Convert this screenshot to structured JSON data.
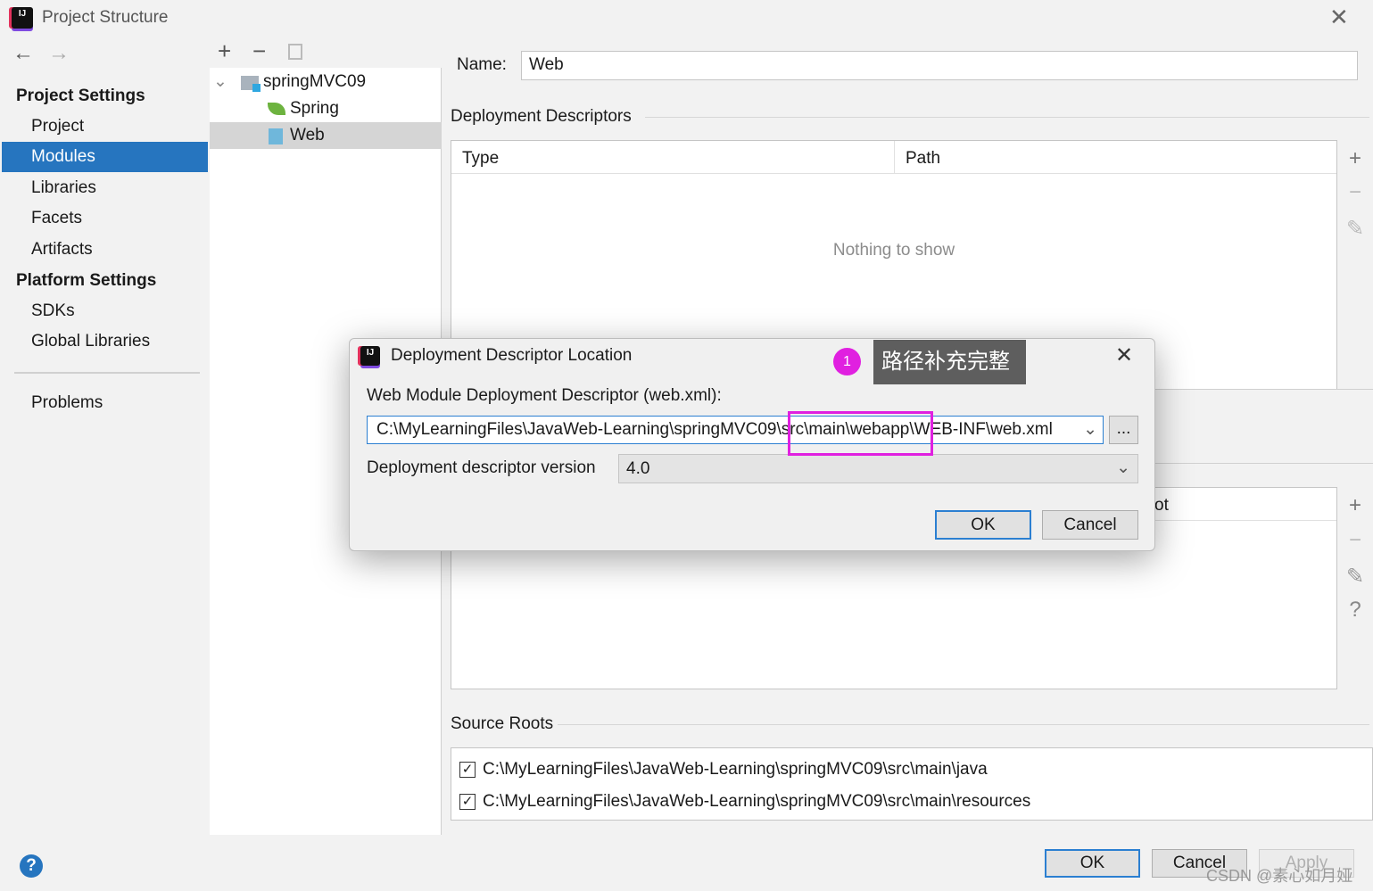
{
  "window": {
    "title": "Project Structure",
    "close_icon": "close-icon"
  },
  "sidebar": {
    "project_settings": "Project Settings",
    "items_top": [
      {
        "label": "Project"
      },
      {
        "label": "Modules",
        "selected": true
      },
      {
        "label": "Libraries"
      },
      {
        "label": "Facets"
      },
      {
        "label": "Artifacts"
      }
    ],
    "platform_settings": "Platform Settings",
    "items_platform": [
      {
        "label": "SDKs"
      },
      {
        "label": "Global Libraries"
      }
    ],
    "problems": "Problems"
  },
  "tree": {
    "root": "springMVC09",
    "children": [
      {
        "label": "Spring"
      },
      {
        "label": "Web",
        "selected": true
      }
    ]
  },
  "right": {
    "name_label": "Name:",
    "name_value": "Web",
    "deployment_descriptors": "Deployment Descriptors",
    "columns": [
      "Type",
      "Path"
    ],
    "empty_text": "Nothing to show",
    "second_table_header_fragment": "ot",
    "source_roots": "Source Roots",
    "roots": [
      {
        "path": "C:\\MyLearningFiles\\JavaWeb-Learning\\springMVC09\\src\\main\\java",
        "checked": true
      },
      {
        "path": "C:\\MyLearningFiles\\JavaWeb-Learning\\springMVC09\\src\\main\\resources",
        "checked": true
      }
    ]
  },
  "footer": {
    "ok": "OK",
    "cancel": "Cancel",
    "apply": "Apply",
    "watermark": "CSDN @素心如月娅"
  },
  "dialog": {
    "title": "Deployment Descriptor Location",
    "descriptor_label": "Web Module Deployment Descriptor (web.xml):",
    "descriptor_path": "C:\\MyLearningFiles\\JavaWeb-Learning\\springMVC09\\src\\main\\webapp\\WEB-INF\\web.xml",
    "browse": "...",
    "version_label": "Deployment descriptor version",
    "version_value": "4.0",
    "ok": "OK",
    "cancel": "Cancel"
  },
  "annotation": {
    "number": "1",
    "text": "路径补充完整",
    "marker_color": "#e020e0",
    "box_color": "#5e5e5e"
  }
}
